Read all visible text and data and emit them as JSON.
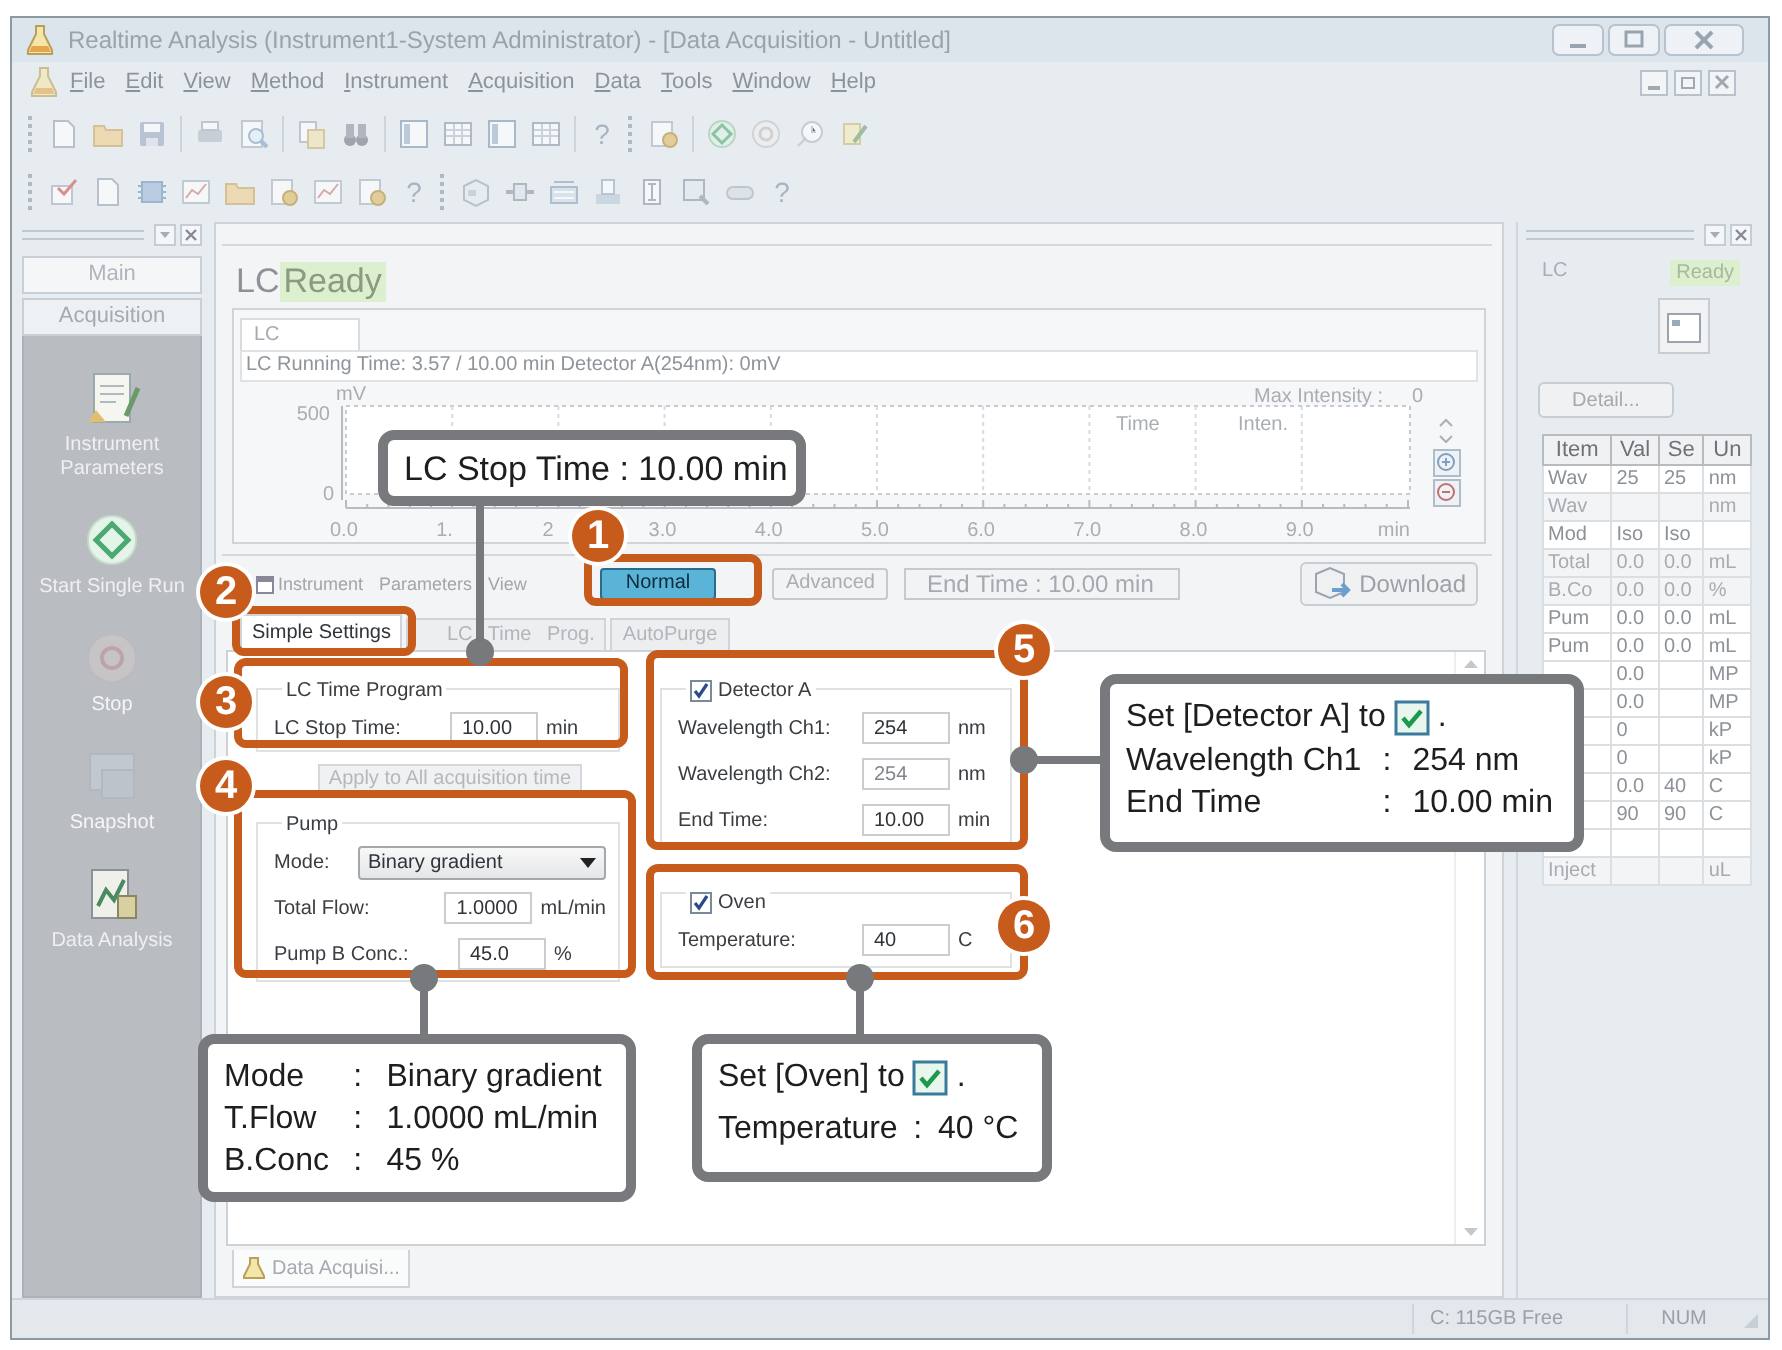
{
  "window": {
    "title": "Realtime Analysis (Instrument1-System Administrator) - [Data Acquisition - Untitled]"
  },
  "menu": [
    "File",
    "Edit",
    "View",
    "Method",
    "Instrument",
    "Acquisition",
    "Data",
    "Tools",
    "Window",
    "Help"
  ],
  "toolbars": [
    {
      "glyphs": [
        "?"
      ]
    },
    {
      "glyphs": [
        "?",
        "?"
      ]
    }
  ],
  "left_pane": {
    "tabs": [
      {
        "label": "Main",
        "selected": false
      },
      {
        "label": "Acquisition",
        "selected": true
      }
    ],
    "items": [
      {
        "label": "Instrument Parameters",
        "disabled": false
      },
      {
        "label": "Start Single Run",
        "disabled": false
      },
      {
        "label": "Stop",
        "disabled": true
      },
      {
        "label": "Snapshot",
        "disabled": true
      },
      {
        "label": "Data Analysis",
        "disabled": false
      }
    ]
  },
  "center": {
    "module": "LC",
    "status": "Ready",
    "tab": {
      "label": "LC",
      "selected": true
    },
    "info": "LC Running Time: 3.57 / 10.00 min Detector A(254nm): 0mV",
    "chart": {
      "y_unit": "mV",
      "y_ticks": [
        "500",
        "0"
      ],
      "x_ticks": [
        "0.0",
        "1.",
        "2",
        "3.0",
        "4.0",
        "5.0",
        "6.0",
        "7.0",
        "8.0",
        "9.0"
      ],
      "x_unit": "min",
      "max_label": "Max Intensity :",
      "max_value": "0",
      "legend": [
        "Time",
        "Inten."
      ]
    },
    "params_title": "Instrument Parameters View",
    "modes": [
      {
        "label": "Normal",
        "selected": true
      },
      {
        "label": "Advanced",
        "selected": false
      }
    ],
    "end_time": "End Time : 10.00 min",
    "download": "Download",
    "tabs": [
      {
        "label": "Simple Settings",
        "selected": true
      },
      {
        "label": "LC Time Prog.",
        "selected": false
      },
      {
        "label": "AutoPurge",
        "selected": false
      }
    ],
    "lc_time_program": {
      "title": "LC Time Program",
      "label": "LC Stop Time:",
      "value": "10.00",
      "unit": "min"
    },
    "apply_button": {
      "label": "Apply to All acquisition time",
      "disabled": true
    },
    "pump": {
      "title": "Pump",
      "mode_label": "Mode:",
      "mode": "Binary gradient",
      "fields": [
        {
          "label": "Total Flow:",
          "value": "1.0000",
          "unit": "mL/min"
        },
        {
          "label": "Pump B Conc.:",
          "value": "45.0",
          "unit": "%"
        }
      ]
    },
    "detector": {
      "title": "Detector A",
      "checked": true,
      "fields": [
        {
          "label": "Wavelength Ch1:",
          "value": "254",
          "unit": "nm",
          "disabled": false
        },
        {
          "label": "Wavelength Ch2:",
          "value": "254",
          "unit": "nm",
          "disabled": true
        },
        {
          "label": "End Time:",
          "value": "10.00",
          "unit": "min",
          "disabled": false
        }
      ]
    },
    "oven": {
      "title": "Oven",
      "checked": true,
      "fields": [
        {
          "label": "Temperature:",
          "value": "40",
          "unit": "C"
        }
      ]
    },
    "doc_tab": "Data Acquisi..."
  },
  "right_pane": {
    "module": "LC",
    "status": "Ready",
    "detail_button": "Detail...",
    "table": {
      "columns": [
        "Item",
        "Val",
        "Se",
        "Un"
      ],
      "rows": [
        {
          "item": "Wav",
          "val": "25",
          "set": "25",
          "unit": "nm",
          "disabled": false
        },
        {
          "item": "Wav",
          "unit": "nm",
          "disabled": true
        },
        {
          "item": "Mod",
          "val": "Iso",
          "set": "Iso",
          "disabled": false
        },
        {
          "item": "Total",
          "val": "0.0",
          "set": "0.0",
          "unit": "mL",
          "disabled": true
        },
        {
          "item": "B.Co",
          "val": "0.0",
          "set": "0.0",
          "unit": "%",
          "disabled": true
        },
        {
          "item": "Pum",
          "val": "0.0",
          "set": "0.0",
          "unit": "mL",
          "disabled": false
        },
        {
          "item": "Pum",
          "val": "0.0",
          "set": "0.0",
          "unit": "mL",
          "disabled": false
        },
        {
          "val": "0.0",
          "unit": "MP",
          "disabled": false
        },
        {
          "val": "0.0",
          "unit": "MP",
          "disabled": false
        },
        {
          "val": "0",
          "unit": "kP",
          "disabled": false
        },
        {
          "val": "0",
          "unit": "kP",
          "disabled": false
        },
        {
          "val": "0.0",
          "set": "40",
          "unit": "C",
          "disabled": false
        },
        {
          "val": "90",
          "set": "90",
          "unit": "C",
          "disabled": false
        },
        {
          "disabled": false
        },
        {
          "item": "Inject",
          "unit": "uL",
          "disabled": true
        }
      ]
    }
  },
  "status_bar": {
    "disk": "C: 115GB Free",
    "num": "NUM"
  },
  "annotations": {
    "badges": [
      "1",
      "2",
      "3",
      "4",
      "5",
      "6"
    ],
    "notes": [
      {
        "kind": "single",
        "text": "LC Stop Time : 10.00 min"
      },
      {
        "kind": "check_list",
        "check_text": "Set [Detector A] to",
        "check_end": ".",
        "rows": [
          {
            "label": "Wavelength Ch1",
            "sep": ":",
            "value": "254 nm"
          },
          {
            "label": "End Time",
            "sep": ":",
            "value": "10.00 min"
          }
        ]
      },
      {
        "kind": "list",
        "rows": [
          {
            "label": "Mode",
            "sep": ":",
            "value": "Binary gradient"
          },
          {
            "label": "T.Flow",
            "sep": ":",
            "value": "1.0000 mL/min"
          },
          {
            "label": "B.Conc",
            "sep": ":",
            "value": "45 %"
          }
        ]
      },
      {
        "kind": "check_list",
        "check_text": "Set [Oven] to",
        "check_end": ".",
        "rows": [
          {
            "label": "Temperature",
            "sep": ":",
            "value": "40 °C"
          }
        ]
      }
    ]
  }
}
